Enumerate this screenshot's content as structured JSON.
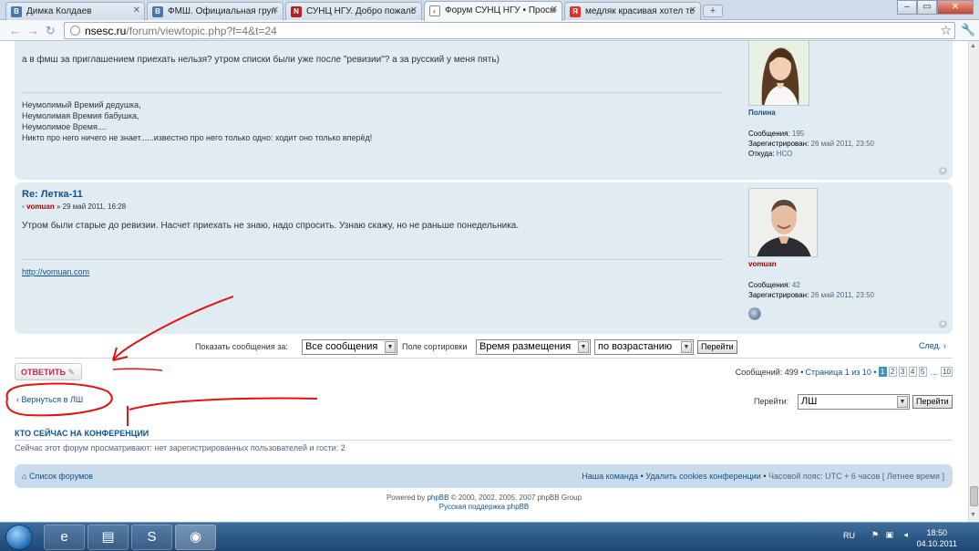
{
  "browser": {
    "tabs": [
      {
        "label": "Димка Колдаев",
        "favicon": "vk-icon",
        "color": "#4a76a8"
      },
      {
        "label": "ФМШ. Официальная груп",
        "favicon": "vk-icon",
        "color": "#4a76a8"
      },
      {
        "label": "СУНЦ НГУ. Добро пожалс",
        "favicon": "nsesc-icon",
        "color": "#b22222"
      },
      {
        "label": "Форум СУНЦ НГУ • Просм",
        "favicon": "page-icon",
        "color": "#888888"
      },
      {
        "label": "медляк красивая хотел те",
        "favicon": "yandex-icon",
        "color": "#e0312b"
      }
    ],
    "new_tab": "+",
    "url_host": "nsesc.ru",
    "url_path": "/forum/viewtopic.php?f=4&t=24"
  },
  "post1": {
    "text": "а в фмш за приглашением приехать нельзя? утром списки были уже после \"ревизии\"? а за русский у меня пять)",
    "signature": [
      "Неумолимый Времий дедушка,",
      "Неумолимая Времия бабушка,",
      "Неумолимое Время....",
      "Никто про него ничего не знает......известно про него только одно: ходит оно только вперёд!"
    ],
    "username": "Полина",
    "username_color": "#105289",
    "messages_label": "Сообщения:",
    "messages": "195",
    "registered_label": "Зарегистрирован:",
    "registered": "26 май 2011, 23:50",
    "from_label": "Откуда:",
    "from": "НСО"
  },
  "post2": {
    "title": "Re: Летка-11",
    "author": "vomuan",
    "date": "» 29 май 2011, 16:28",
    "text": "Утром были старые до ревизии. Насчет приехать не знаю, надо спросить. Узнаю скажу, но не раньше понедельника.",
    "signature_link": "http://vomuan.com",
    "username": "vomuan",
    "username_color": "#aa0000",
    "messages_label": "Сообщения:",
    "messages": "42",
    "registered_label": "Зарегистрирован:",
    "registered": "26 май 2011, 23:50"
  },
  "sortbar": {
    "show_label": "Показать сообщения за:",
    "show_value": "Все сообщения",
    "sort_label": "Поле сортировки",
    "sort_value": "Время размещения",
    "order_value": "по возрастанию",
    "go_label": "Перейти",
    "next_label": "След."
  },
  "reply_label": "ОТВЕТИТЬ",
  "pagination": {
    "summary": "Сообщений: 499 •",
    "page_text": "Страница 1 из 10 •",
    "pages": [
      "1",
      "2",
      "3",
      "4",
      "5"
    ],
    "ellipsis": "...",
    "last": "10"
  },
  "back_link": "Вернуться в ЛШ",
  "jump": {
    "label": "Перейти:",
    "value": "ЛШ",
    "button": "Перейти"
  },
  "online": {
    "title": "КТО СЕЙЧАС НА КОНФЕРЕНЦИИ",
    "text": "Сейчас этот форум просматривают: нет зарегистрированных пользователей и гости: 2"
  },
  "footer": {
    "index_link": "Список форумов",
    "team_link": "Наша команда",
    "delete_cookies": "Удалить cookies конференции",
    "timezone": "Часовой пояс: UTC + 6 часов [ Летнее время ]",
    "powered_prefix": "Powered by",
    "powered_link": "phpBB",
    "powered_suffix": "© 2000, 2002, 2005, 2007 phpBB Group",
    "support": "Русская поддержка phpBB"
  },
  "taskbar": {
    "lang": "RU",
    "time": "18:50",
    "date": "04.10.2011"
  },
  "colors": {
    "post_bg": "#e1ebf2",
    "link": "#105289",
    "annotation": "#e01414"
  }
}
